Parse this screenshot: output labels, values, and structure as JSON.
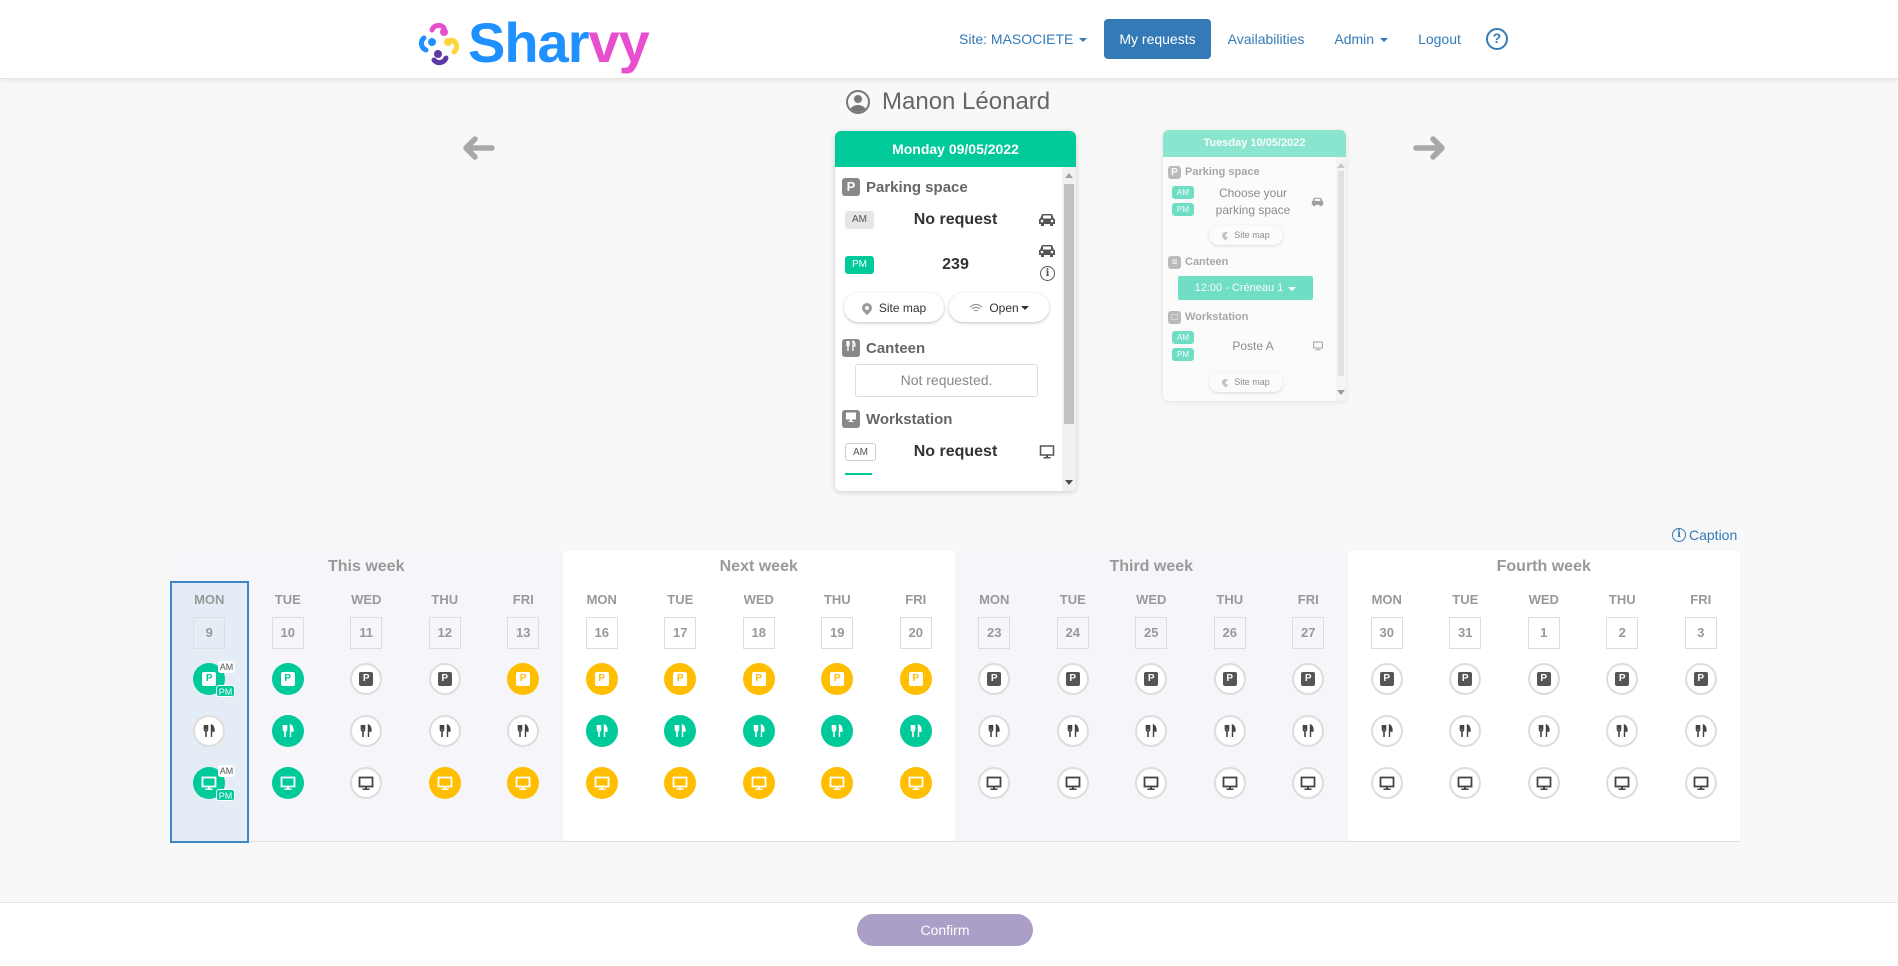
{
  "brand": {
    "part1": "Shar",
    "part2": "vy",
    "colors": {
      "blue": "#1e90ff",
      "pink": "#e84fcf",
      "yellow": "#ffd43b",
      "purple": "#5b3aa6"
    }
  },
  "nav": {
    "site": "Site: MASOCIETE",
    "my_requests": "My requests",
    "availabilities": "Availabilities",
    "admin": "Admin",
    "logout": "Logout",
    "help": "?"
  },
  "user": {
    "name": "Manon Léonard"
  },
  "current_day": {
    "title": "Monday 09/05/2022",
    "parking": {
      "title": "Parking space",
      "am": {
        "label": "AM",
        "value": "No request"
      },
      "pm": {
        "label": "PM",
        "value": "239"
      },
      "site_map": "Site map",
      "open": "Open"
    },
    "canteen": {
      "title": "Canteen",
      "status": "Not requested."
    },
    "workstation": {
      "title": "Workstation",
      "am": {
        "label": "AM",
        "value": "No request"
      }
    }
  },
  "next_day": {
    "title": "Tuesday 10/05/2022",
    "parking": {
      "title": "Parking space",
      "am": "AM",
      "pm": "PM",
      "value": "Choose your parking space",
      "site_map": "Site map"
    },
    "canteen": {
      "title": "Canteen",
      "slot": "12:00 - Créneau 1"
    },
    "workstation": {
      "title": "Workstation",
      "am": "AM",
      "pm": "PM",
      "value": "Poste A",
      "site_map": "Site map"
    }
  },
  "caption": "Caption",
  "status_colors": {
    "booked": "#00c99a",
    "pending": "#ffbe00",
    "none": "#ffffff"
  },
  "weeks": [
    {
      "title": "This week",
      "days": [
        {
          "name": "MON",
          "num": "9",
          "selected": true,
          "parking": "green",
          "parking_half": true,
          "canteen": "grey",
          "workstation": "green",
          "workstation_half": true
        },
        {
          "name": "TUE",
          "num": "10",
          "parking": "green",
          "canteen": "green",
          "workstation": "green"
        },
        {
          "name": "WED",
          "num": "11",
          "parking": "grey",
          "canteen": "grey",
          "workstation": "grey"
        },
        {
          "name": "THU",
          "num": "12",
          "parking": "grey",
          "canteen": "grey",
          "workstation": "yellow"
        },
        {
          "name": "FRI",
          "num": "13",
          "parking": "yellow",
          "canteen": "grey",
          "workstation": "yellow"
        }
      ]
    },
    {
      "title": "Next week",
      "days": [
        {
          "name": "MON",
          "num": "16",
          "parking": "yellow",
          "canteen": "green",
          "workstation": "yellow"
        },
        {
          "name": "TUE",
          "num": "17",
          "parking": "yellow",
          "canteen": "green",
          "workstation": "yellow"
        },
        {
          "name": "WED",
          "num": "18",
          "parking": "yellow",
          "canteen": "green",
          "workstation": "yellow"
        },
        {
          "name": "THU",
          "num": "19",
          "parking": "yellow",
          "canteen": "green",
          "workstation": "yellow"
        },
        {
          "name": "FRI",
          "num": "20",
          "parking": "yellow",
          "canteen": "green",
          "workstation": "yellow"
        }
      ]
    },
    {
      "title": "Third week",
      "days": [
        {
          "name": "MON",
          "num": "23",
          "parking": "grey",
          "canteen": "grey",
          "workstation": "grey"
        },
        {
          "name": "TUE",
          "num": "24",
          "parking": "grey",
          "canteen": "grey",
          "workstation": "grey"
        },
        {
          "name": "WED",
          "num": "25",
          "parking": "grey",
          "canteen": "grey",
          "workstation": "grey"
        },
        {
          "name": "THU",
          "num": "26",
          "parking": "grey",
          "canteen": "grey",
          "workstation": "grey"
        },
        {
          "name": "FRI",
          "num": "27",
          "parking": "grey",
          "canteen": "grey",
          "workstation": "grey"
        }
      ]
    },
    {
      "title": "Fourth week",
      "days": [
        {
          "name": "MON",
          "num": "30",
          "parking": "grey",
          "canteen": "grey",
          "workstation": "grey"
        },
        {
          "name": "TUE",
          "num": "31",
          "parking": "grey",
          "canteen": "grey",
          "workstation": "grey"
        },
        {
          "name": "WED",
          "num": "1",
          "parking": "grey",
          "canteen": "grey",
          "workstation": "grey"
        },
        {
          "name": "THU",
          "num": "2",
          "parking": "grey",
          "canteen": "grey",
          "workstation": "grey"
        },
        {
          "name": "FRI",
          "num": "3",
          "parking": "grey",
          "canteen": "grey",
          "workstation": "grey"
        }
      ]
    }
  ],
  "half_labels": {
    "am": "AM",
    "pm": "PM"
  },
  "parking_glyph": "P",
  "confirm": "Confirm"
}
